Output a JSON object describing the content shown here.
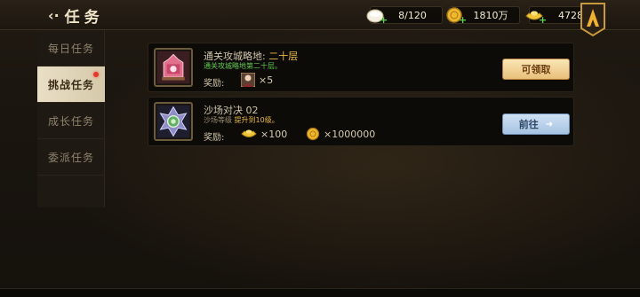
{
  "header": {
    "back_glyph": "‹·",
    "title": "任务"
  },
  "resources": [
    {
      "name": "stamina",
      "value": "8/120",
      "plus": "+"
    },
    {
      "name": "gold",
      "value": "1810万",
      "plus": "+"
    },
    {
      "name": "ingot",
      "value": "4728",
      "plus": "+"
    }
  ],
  "tabs": [
    {
      "label": "每日任务",
      "active": false
    },
    {
      "label": "挑战任务",
      "active": true,
      "has_dot": true
    },
    {
      "label": "成长任务",
      "active": false
    },
    {
      "label": "委派任务",
      "active": false
    }
  ],
  "tasks": [
    {
      "name": "通关攻城略地:",
      "name_highlight": "二十层",
      "desc": "通关攻城略地第二十层。",
      "reward_label": "奖励:",
      "rewards": [
        {
          "icon": "hero-portrait-icon",
          "count": "×5"
        }
      ],
      "button": "可领取"
    },
    {
      "name": "沙场对决 02",
      "desc_prefix": "沙场等级",
      "desc_highlight": "提升到10级。",
      "reward_label": "奖励:",
      "rewards": [
        {
          "icon": "ingot-icon",
          "count": "×100"
        },
        {
          "icon": "gold-coin-icon",
          "count": "×1000000"
        }
      ],
      "button": "前往"
    }
  ],
  "colors": {
    "accent_gold": "#e8b94a",
    "desc_green": "#62c84e",
    "claim_button": "#e8bf7a",
    "go_button": "#a6c3e2",
    "active_tab": "#e9dfc6"
  }
}
